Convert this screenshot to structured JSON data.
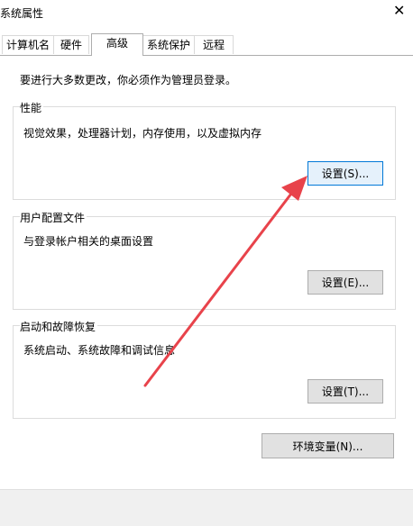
{
  "window": {
    "title": "系统属性",
    "close_glyph": "✕"
  },
  "tabs": [
    {
      "label": "计算机名",
      "active": false
    },
    {
      "label": "硬件",
      "active": false
    },
    {
      "label": "高级",
      "active": true
    },
    {
      "label": "系统保护",
      "active": false
    },
    {
      "label": "远程",
      "active": false
    }
  ],
  "admin_hint": "要进行大多数更改，你必须作为管理员登录。",
  "performance": {
    "label": "性能",
    "description": "视觉效果，处理器计划，内存使用，以及虚拟内存",
    "button": "设置(S)..."
  },
  "user_profiles": {
    "label": "用户配置文件",
    "description": "与登录帐户相关的桌面设置",
    "button": "设置(E)..."
  },
  "startup_recovery": {
    "label": "启动和故障恢复",
    "description": "系统启动、系统故障和调试信息",
    "button": "设置(T)..."
  },
  "env_button": "环境变量(N)...",
  "colors": {
    "annotation_arrow": "#e8434b",
    "focus_border": "#0078d7"
  }
}
